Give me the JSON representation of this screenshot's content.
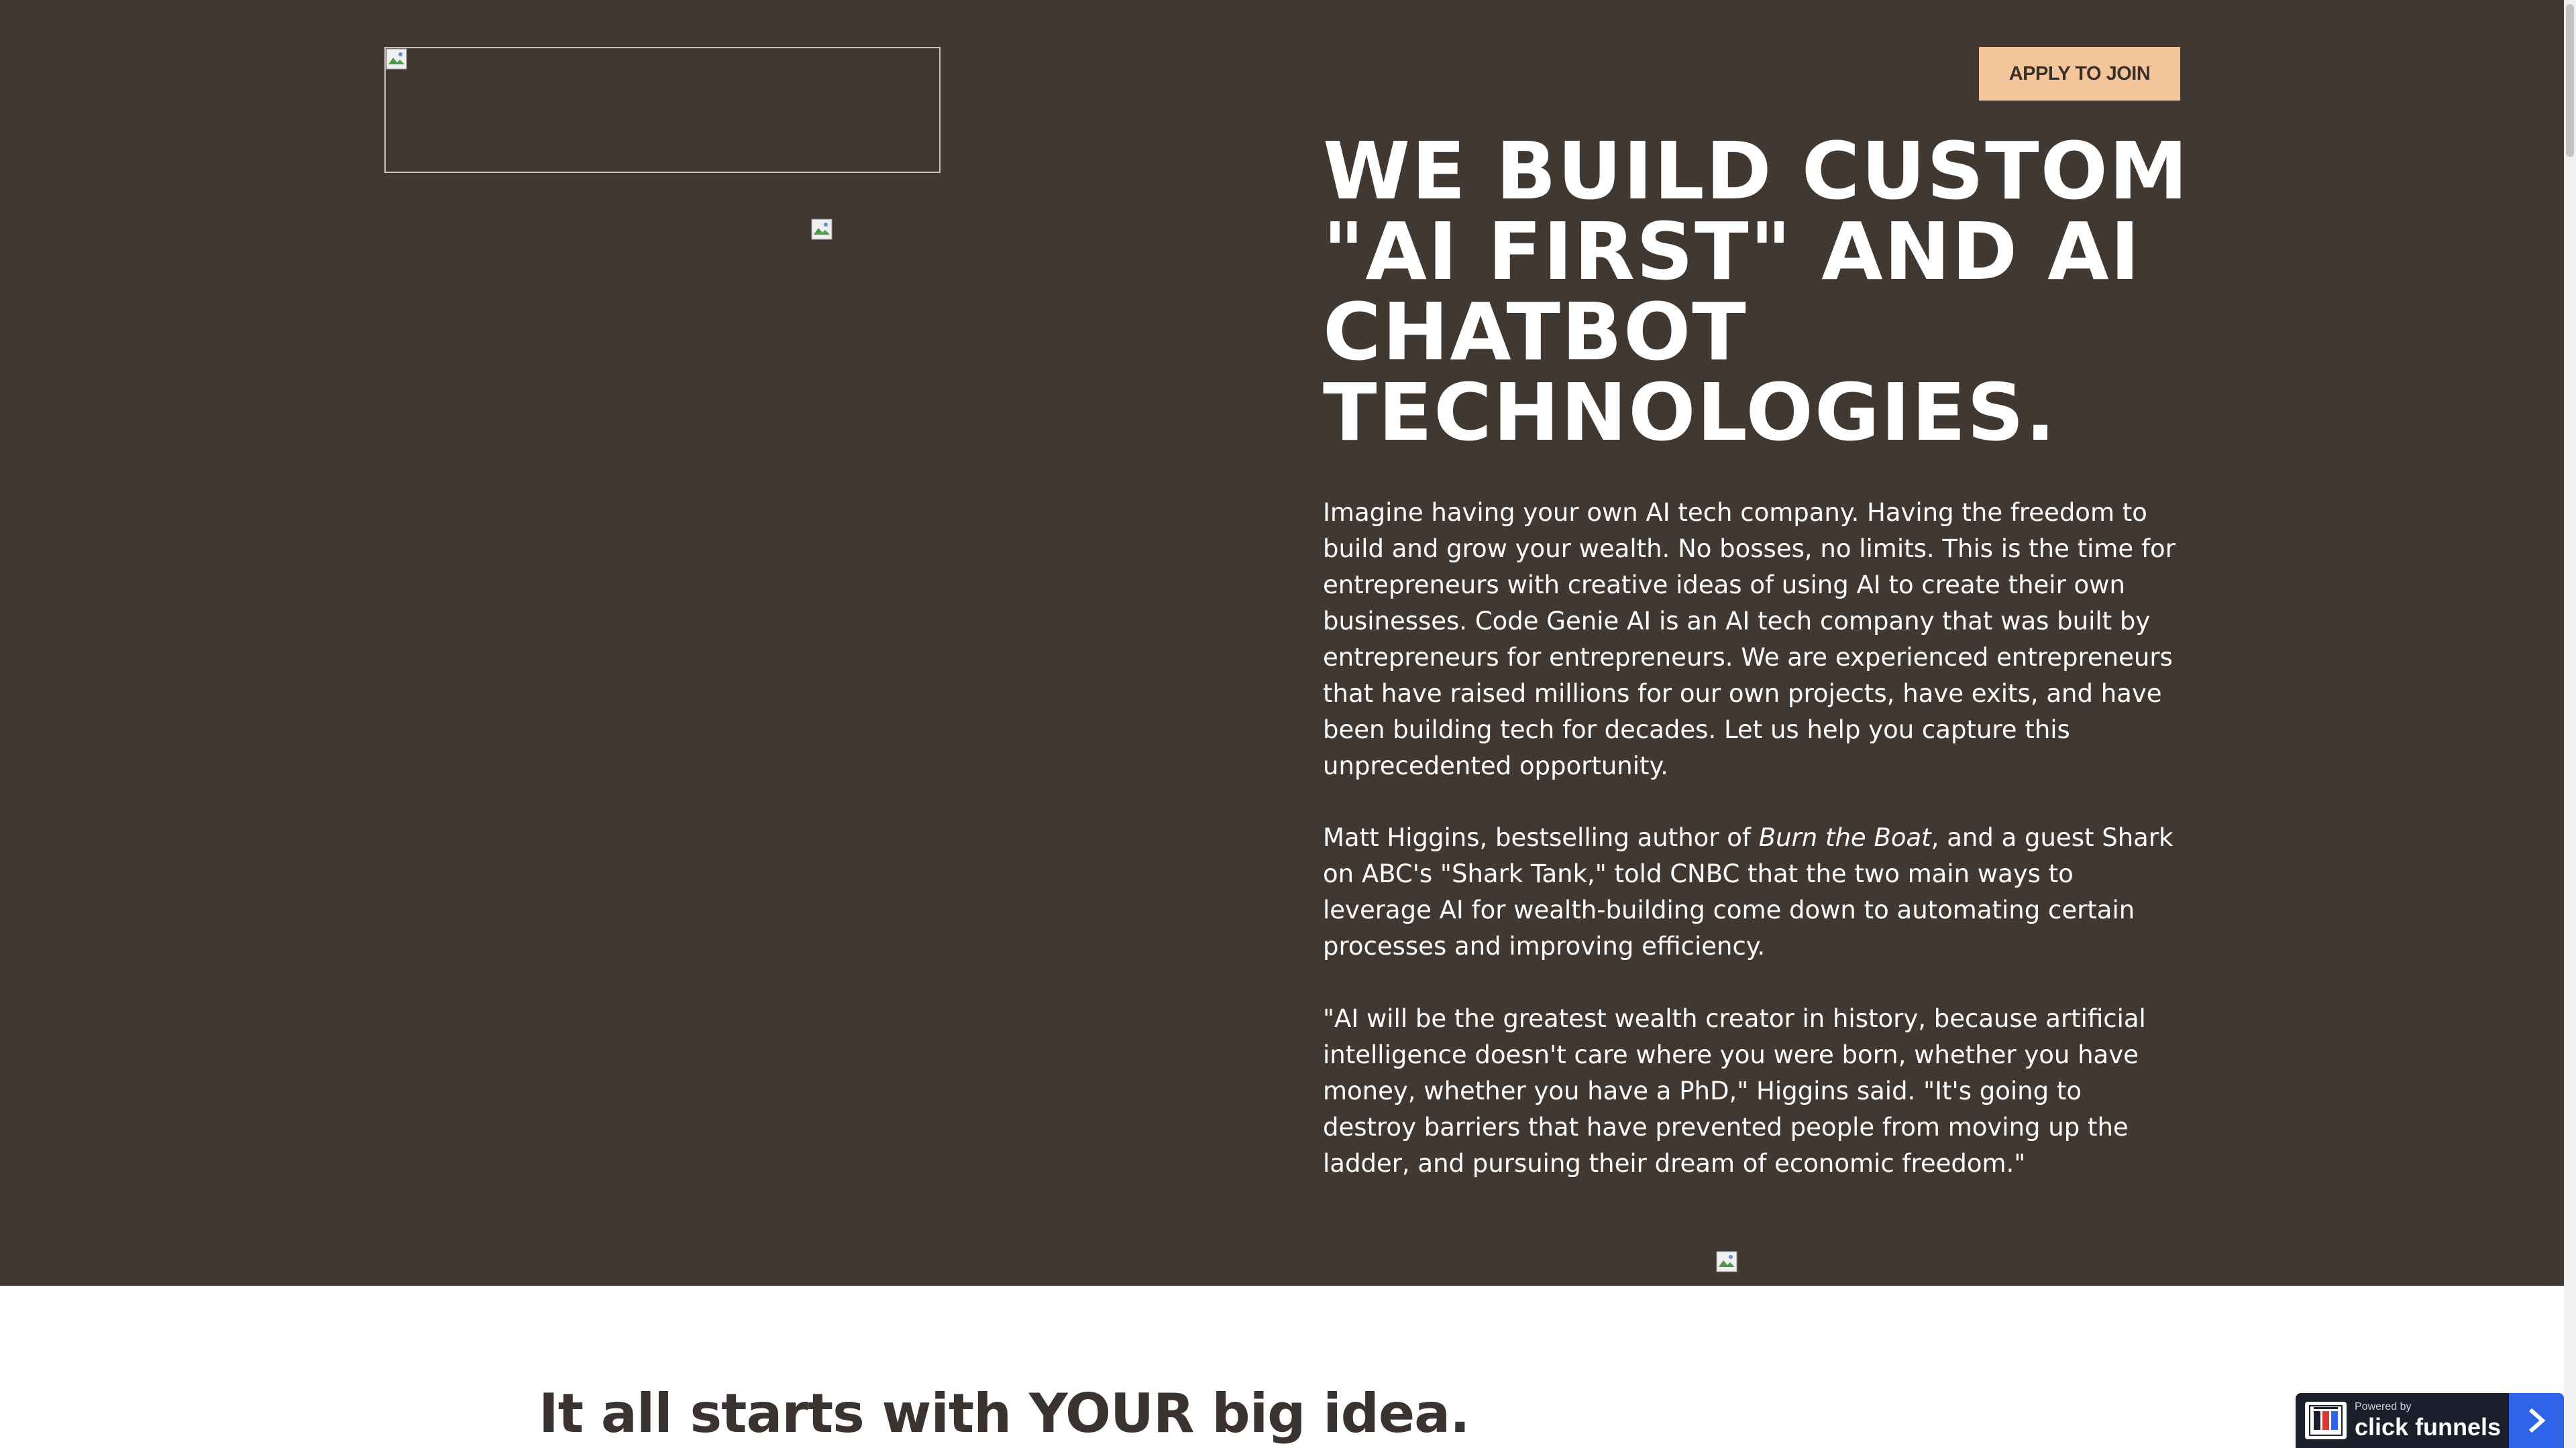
{
  "header": {
    "apply_button_label": "APPLY TO JOIN",
    "logo_image_icon": "broken-image-icon"
  },
  "hero": {
    "background_color": "#413831",
    "headline": "WE BUILD CUSTOM \"AI FIRST\" AND AI CHATBOT TECHNOLOGIES.",
    "paragraph1": "Imagine having your own AI tech company.  Having the freedom to build and grow your wealth.  No bosses, no limits.  This is the time for entrepreneurs with creative ideas of using AI to create their own businesses.  Code Genie AI is an AI tech company that was built by entrepreneurs for entrepreneurs.  We are experienced entrepreneurs that have raised millions for our own projects, have exits, and have been building tech for decades.  Let us help you capture this unprecedented opportunity.",
    "paragraph2": {
      "before": "Matt Higgins, bestselling author of ",
      "italic": "Burn the Boat",
      "after": ", and a guest Shark on ABC's \"Shark Tank,\" told CNBC that the two main ways to leverage AI for wealth-building come down to automating certain processes and improving efficiency."
    },
    "paragraph3": "\"AI will be the greatest wealth creator in history, because artificial intelligence doesn't care where you were born, whether you have money, whether you have a PhD,\" Higgins said. \"It's going to destroy barriers that have prevented people from moving up the ladder, and pursuing their dream of economic freedom.\""
  },
  "section2": {
    "title": "It all starts with YOUR big idea."
  },
  "badge": {
    "powered_by": "Powered by",
    "brand": "click funnels",
    "arrow_icon": "chevron-right-icon"
  },
  "colors": {
    "button_bg": "#f5c69c",
    "badge_bg": "#1a1f2b",
    "badge_arrow_bg": "#2f63e8",
    "section2_text": "#3a3330"
  }
}
